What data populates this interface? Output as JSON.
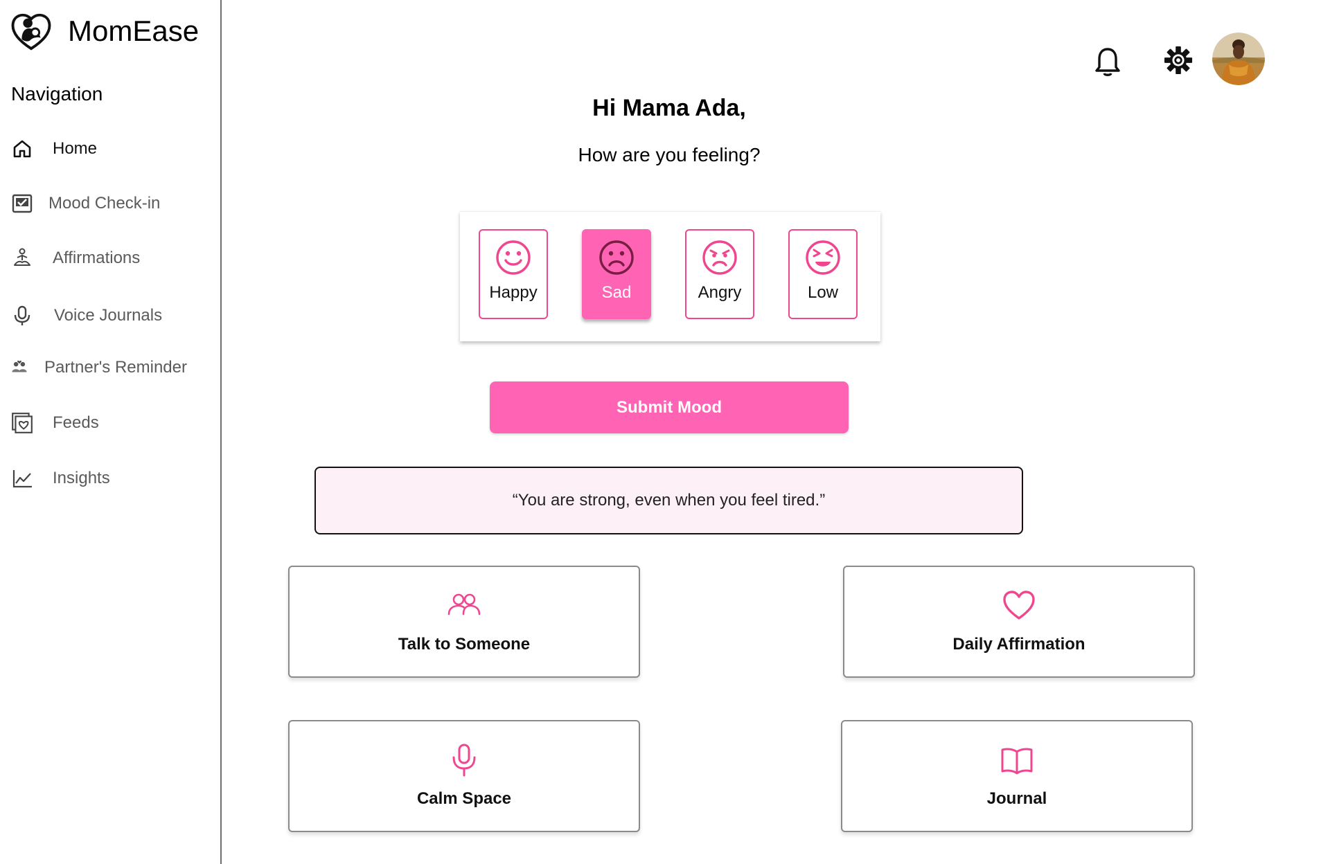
{
  "app": {
    "name": "MomEase",
    "logo_icon": "mother-baby-heart-icon"
  },
  "sidebar": {
    "heading": "Navigation",
    "items": [
      {
        "label": "Home",
        "icon": "home-icon",
        "active": true
      },
      {
        "label": "Mood Check-in",
        "icon": "checkbox-icon",
        "active": false
      },
      {
        "label": "Affirmations",
        "icon": "meditation-icon",
        "active": false
      },
      {
        "label": "Voice Journals",
        "icon": "microphone-icon",
        "active": false
      },
      {
        "label": "Partner's Reminder",
        "icon": "couple-icon",
        "active": false
      },
      {
        "label": "Feeds",
        "icon": "feed-heart-icon",
        "active": false
      },
      {
        "label": "Insights",
        "icon": "line-chart-icon",
        "active": false
      }
    ]
  },
  "header": {
    "notification_icon": "bell-icon",
    "settings_icon": "gear-icon",
    "avatar": "user-avatar"
  },
  "main": {
    "greeting": "Hi Mama Ada,",
    "question": "How are you feeling?",
    "moods": [
      {
        "label": "Happy",
        "icon": "smile-face-icon",
        "selected": false
      },
      {
        "label": "Sad",
        "icon": "sad-face-icon",
        "selected": true
      },
      {
        "label": "Angry",
        "icon": "angry-face-icon",
        "selected": false
      },
      {
        "label": "Low",
        "icon": "tired-face-icon",
        "selected": false
      }
    ],
    "submit_label": "Submit Mood",
    "quote": "“You are strong, even when you feel tired.”",
    "cards": [
      {
        "label": "Talk to Someone",
        "icon": "people-icon"
      },
      {
        "label": "Daily Affirmation",
        "icon": "heart-icon"
      },
      {
        "label": "Calm Space",
        "icon": "microphone-icon"
      },
      {
        "label": "Journal",
        "icon": "book-icon"
      }
    ]
  },
  "colors": {
    "accent": "#ff63b4",
    "accent_border": "#f0468f",
    "quote_background": "#fdf0f7",
    "text_muted": "#5a5a5a"
  }
}
